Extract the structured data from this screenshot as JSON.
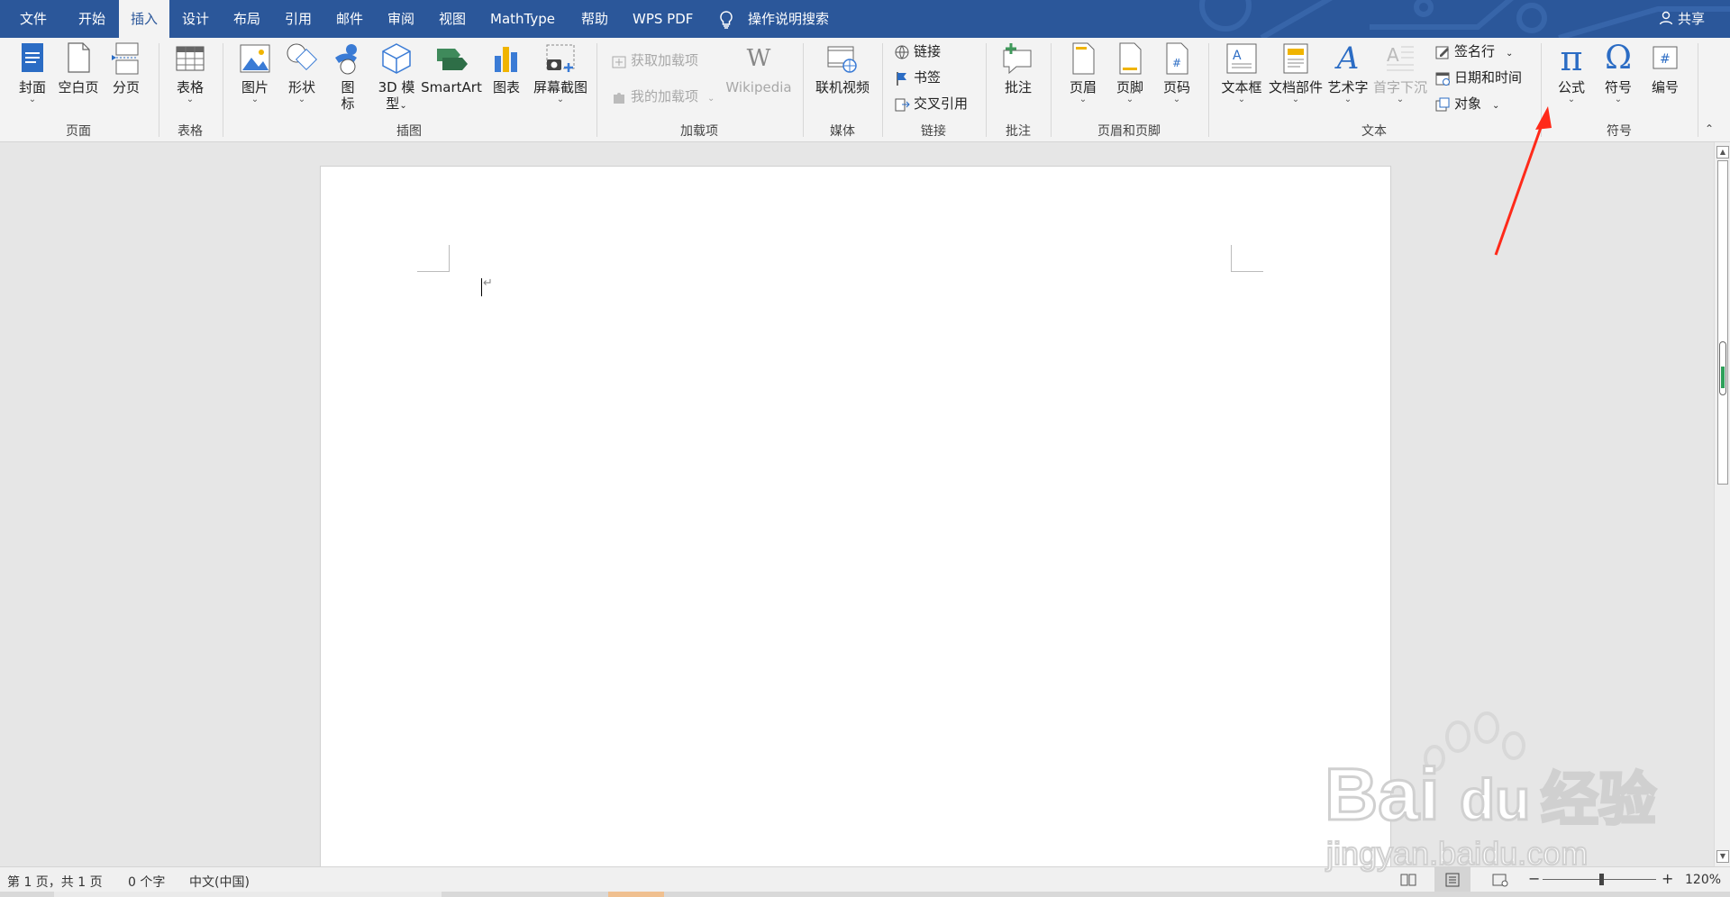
{
  "menubar": {
    "tabs": [
      "文件",
      "开始",
      "插入",
      "设计",
      "布局",
      "引用",
      "邮件",
      "审阅",
      "视图",
      "MathType",
      "帮助",
      "WPS PDF"
    ],
    "search": "操作说明搜索",
    "share": "共享",
    "active_tab": "插入"
  },
  "ribbon": {
    "groups": {
      "pages": {
        "label": "页面",
        "cover": "封面",
        "blank": "空白页",
        "break": "分页"
      },
      "tables": {
        "label": "表格",
        "table": "表格"
      },
      "illustrations": {
        "label": "插图",
        "picture": "图片",
        "shapes": "形状",
        "icons_1": "图",
        "icons_2": "标",
        "model_1": "3D 模",
        "model_2": "型",
        "smartart": "SmartArt",
        "chart": "图表",
        "screenshot": "屏幕截图"
      },
      "addins": {
        "label": "加载项",
        "get": "获取加载项",
        "my": "我的加载项",
        "wikipedia": "Wikipedia"
      },
      "media": {
        "label": "媒体",
        "video": "联机视频"
      },
      "links": {
        "label": "链接",
        "link": "链接",
        "bookmark": "书签",
        "crossref": "交叉引用"
      },
      "comments": {
        "label": "批注",
        "comment": "批注"
      },
      "headerfooter": {
        "label": "页眉和页脚",
        "header": "页眉",
        "footer": "页脚",
        "pagenum": "页码"
      },
      "text": {
        "label": "文本",
        "textbox": "文本框",
        "quickparts": "文档部件",
        "wordart": "艺术字",
        "dropcap": "首字下沉",
        "signature": "签名行",
        "datetime": "日期和时间",
        "object": "对象"
      },
      "symbols": {
        "label": "符号",
        "equation": "公式",
        "symbol": "符号",
        "number": "编号"
      }
    }
  },
  "statusbar": {
    "page": "第 1 页，共 1 页",
    "words": "0 个字",
    "language": "中文(中国)",
    "zoom": "120%",
    "zoom_minus": "−",
    "zoom_plus": "+"
  },
  "watermark": {
    "brand": "Bai",
    "brand2": "du",
    "cn": "经验",
    "url": "jingyan.baidu.com"
  },
  "colors": {
    "accent": "#2b579a",
    "arrow": "#ff2a1a"
  }
}
